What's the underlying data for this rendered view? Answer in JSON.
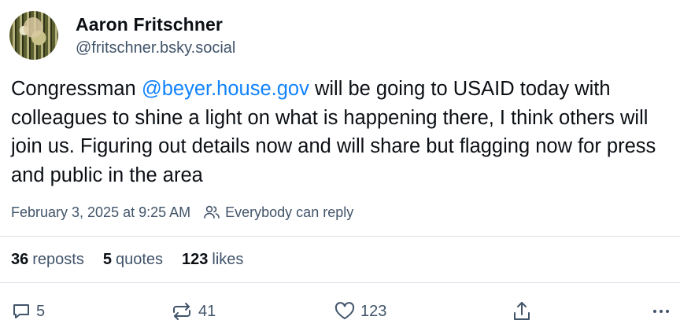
{
  "author": {
    "display_name": "Aaron Fritschner",
    "handle": "@fritschner.bsky.social"
  },
  "post": {
    "text_before": "Congressman ",
    "mention": "@beyer.house.gov",
    "text_after": " will be going to USAID today with colleagues to shine a light on what is happening there, I think others will join us. Figuring out details now and will share but flagging now for press and public in the area"
  },
  "meta": {
    "timestamp": "February 3, 2025 at 9:25 AM",
    "reply_setting": "Everybody can reply"
  },
  "stats": {
    "reposts_count": "36",
    "reposts_label": "reposts",
    "quotes_count": "5",
    "quotes_label": "quotes",
    "likes_count": "123",
    "likes_label": "likes"
  },
  "actions": {
    "reply_count": "5",
    "repost_count": "41",
    "like_count": "123"
  },
  "icons": {
    "reply": "speech-bubble-icon",
    "repost": "repost-arrows-icon",
    "like": "heart-icon",
    "share": "share-icon",
    "more": "more-dots-icon",
    "reply_setting": "people-icon"
  },
  "colors": {
    "mention": "#1083fe",
    "muted": "#41546a",
    "text": "#0b0f14",
    "divider": "#dce2ea"
  }
}
